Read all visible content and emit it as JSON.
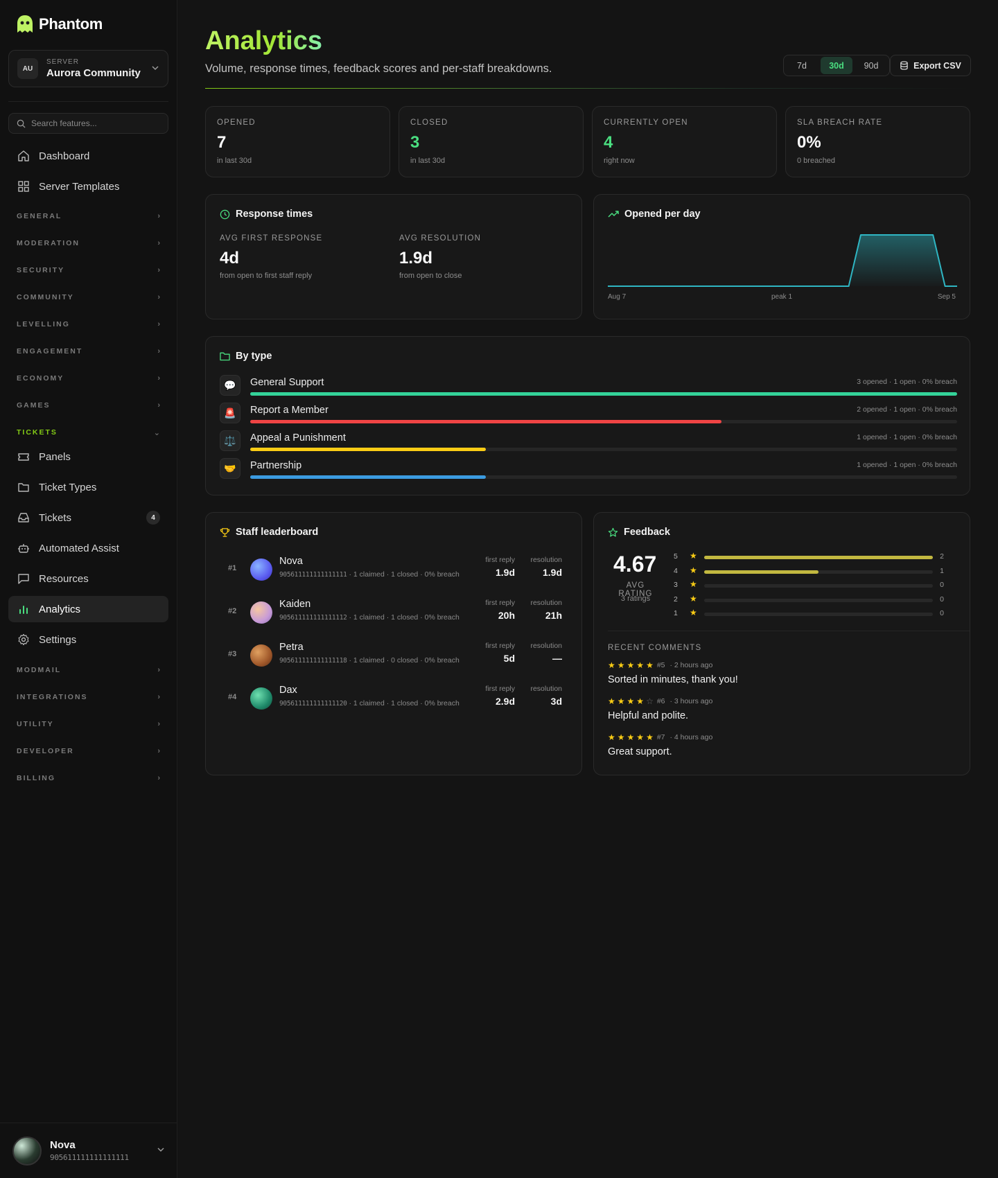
{
  "brand": {
    "name": "Phantom"
  },
  "server": {
    "kicker": "SERVER",
    "avatar": "AU",
    "name": "Aurora Community"
  },
  "search": {
    "placeholder": "Search features..."
  },
  "nav": {
    "dashboard": "Dashboard",
    "templates": "Server Templates",
    "sections": {
      "general": "GENERAL",
      "moderation": "MODERATION",
      "security": "SECURITY",
      "community": "COMMUNITY",
      "levelling": "LEVELLING",
      "engagement": "ENGAGEMENT",
      "economy": "ECONOMY",
      "games": "GAMES",
      "tickets": "TICKETS",
      "modmail": "MODMAIL",
      "integrations": "INTEGRATIONS",
      "utility": "UTILITY",
      "developer": "DEVELOPER",
      "billing": "BILLING"
    },
    "tickets": {
      "panels": "Panels",
      "ticket_types": "Ticket Types",
      "tickets": "Tickets",
      "tickets_badge": "4",
      "automated_assist": "Automated Assist",
      "resources": "Resources",
      "analytics": "Analytics",
      "settings": "Settings"
    }
  },
  "user": {
    "name": "Nova",
    "id": "905611111111111111"
  },
  "page": {
    "title": "Analytics",
    "subtitle": "Volume, response times, feedback scores and per-staff breakdowns.",
    "ranges": [
      "7d",
      "30d",
      "90d"
    ],
    "active_range": "30d",
    "export_label": "Export CSV"
  },
  "stats": [
    {
      "label": "OPENED",
      "value": "7",
      "note": "in last 30d"
    },
    {
      "label": "CLOSED",
      "value": "3",
      "note": "in last 30d"
    },
    {
      "label": "CURRENTLY OPEN",
      "value": "4",
      "note": "right now"
    },
    {
      "label": "SLA BREACH RATE",
      "value": "0%",
      "note": "0 breached"
    }
  ],
  "response_times": {
    "title": "Response times",
    "first_label": "AVG FIRST RESPONSE",
    "first_value": "4d",
    "first_note": "from open to first staff reply",
    "res_label": "AVG RESOLUTION",
    "res_value": "1.9d",
    "res_note": "from open to close"
  },
  "opened_per_day": {
    "title": "Opened per day",
    "x_start": "Aug 7",
    "x_mid": "peak 1",
    "x_end": "Sep 5",
    "color": "#2fb6c3"
  },
  "chart_data": {
    "type": "area",
    "x_start": "Aug 7",
    "x_end": "Sep 5",
    "values": [
      0,
      0,
      0,
      0,
      0,
      0,
      0,
      0,
      0,
      0,
      0,
      0,
      0,
      0,
      0,
      0,
      0,
      0,
      0,
      0,
      0,
      1,
      1,
      1,
      1,
      1,
      1,
      1,
      0,
      0
    ],
    "ylim": [
      0,
      1
    ]
  },
  "by_type": {
    "title": "By type",
    "items": [
      {
        "icon": "💬",
        "name": "General Support",
        "meta": "3 opened · 1 open · 0% breach",
        "fraction": 1.0,
        "color": "#34d399"
      },
      {
        "icon": "🚨",
        "name": "Report a Member",
        "meta": "2 opened · 1 open · 0% breach",
        "fraction": 0.667,
        "color": "#ef4444"
      },
      {
        "icon": "⚖️",
        "name": "Appeal a Punishment",
        "meta": "1 opened · 1 open · 0% breach",
        "fraction": 0.333,
        "color": "#facc15"
      },
      {
        "icon": "🤝",
        "name": "Partnership",
        "meta": "1 opened · 1 open · 0% breach",
        "fraction": 0.333,
        "color": "#3b9be0"
      }
    ]
  },
  "leaderboard": {
    "title": "Staff leaderboard",
    "col_first": "first reply",
    "col_res": "resolution",
    "rows": [
      {
        "rank": "#1",
        "name": "Nova",
        "id": "905611111111111111",
        "meta": " · 1 claimed · 1 closed · 0% breach",
        "first": "1.9d",
        "res": "1.9d"
      },
      {
        "rank": "#2",
        "name": "Kaiden",
        "id": "905611111111111112",
        "meta": " · 1 claimed · 1 closed · 0% breach",
        "first": "20h",
        "res": "21h"
      },
      {
        "rank": "#3",
        "name": "Petra",
        "id": "905611111111111118",
        "meta": " · 1 claimed · 0 closed · 0% breach",
        "first": "5d",
        "res": "—"
      },
      {
        "rank": "#4",
        "name": "Dax",
        "id": "905611111111111120",
        "meta": " · 1 claimed · 1 closed · 0% breach",
        "first": "2.9d",
        "res": "3d"
      }
    ]
  },
  "feedback": {
    "title": "Feedback",
    "avg": "4.67",
    "avg_label": "AVG RATING",
    "count": "3 ratings",
    "distribution": [
      {
        "stars": "5",
        "count": "2",
        "fraction": 1.0
      },
      {
        "stars": "4",
        "count": "1",
        "fraction": 0.5
      },
      {
        "stars": "3",
        "count": "0",
        "fraction": 0
      },
      {
        "stars": "2",
        "count": "0",
        "fraction": 0
      },
      {
        "stars": "1",
        "count": "0",
        "fraction": 0
      }
    ],
    "recent_title": "RECENT COMMENTS",
    "comments": [
      {
        "rating": 5,
        "ticket": "#5",
        "time": "· 2 hours ago",
        "text": "Sorted in minutes, thank you!"
      },
      {
        "rating": 4,
        "ticket": "#6",
        "time": "· 3 hours ago",
        "text": "Helpful and polite."
      },
      {
        "rating": 5,
        "ticket": "#7",
        "time": "· 4 hours ago",
        "text": "Great support."
      }
    ]
  }
}
